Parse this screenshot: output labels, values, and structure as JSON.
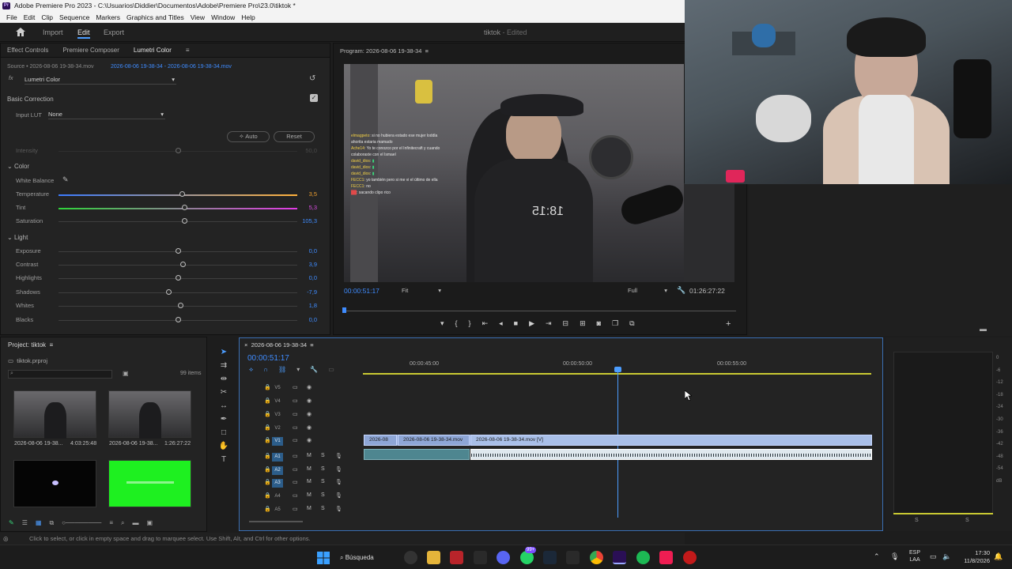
{
  "window": {
    "title": "Adobe Premiere Pro 2023 - C:\\Usuarios\\Diddier\\Documentos\\Adobe\\Premiere Pro\\23.0\\tiktok *",
    "app_badge": "Pr"
  },
  "menu": [
    "File",
    "Edit",
    "Clip",
    "Sequence",
    "Markers",
    "Graphics and Titles",
    "View",
    "Window",
    "Help"
  ],
  "workspace": {
    "tabs": [
      "Import",
      "Edit",
      "Export"
    ],
    "active": "Edit",
    "project_title": "tiktok",
    "project_status": "- Edited"
  },
  "left_panel": {
    "tabs": [
      "Effect Controls",
      "Premiere Composer",
      "Lumetri Color"
    ],
    "source": "Source • 2026-08-06 19-38-34.mov",
    "clip": "2026-08-06 19-38-34 - 2026-08-06 19-38-34.mov",
    "effect": "Lumetri Color",
    "fx": "fx",
    "basic_correction": "Basic Correction",
    "input_lut_label": "Input LUT",
    "input_lut_value": "None",
    "auto": "Auto",
    "reset": "Reset",
    "intensity_label": "Intensity",
    "intensity_value": "50,0",
    "color_section": "Color",
    "white_balance": "White Balance",
    "light_section": "Light",
    "sliders": [
      {
        "label": "Temperature",
        "value": "3,5",
        "pos": 0.52
      },
      {
        "label": "Tint",
        "value": "5,3",
        "pos": 0.53
      },
      {
        "label": "Saturation",
        "value": "105,3",
        "pos": 0.53
      },
      {
        "label": "Exposure",
        "value": "0,0",
        "pos": 0.5
      },
      {
        "label": "Contrast",
        "value": "3,9",
        "pos": 0.52
      },
      {
        "label": "Highlights",
        "value": "0,0",
        "pos": 0.5
      },
      {
        "label": "Shadows",
        "value": "-7,9",
        "pos": 0.46
      },
      {
        "label": "Whites",
        "value": "1,8",
        "pos": 0.51
      },
      {
        "label": "Blacks",
        "value": "0,0",
        "pos": 0.5
      }
    ]
  },
  "program": {
    "title": "Program: 2026-08-06 19-38-34",
    "timecode": "00:00:51:17",
    "fit": "Fit",
    "quality": "Full",
    "duration": "01:26:27:22",
    "shirt_text": "18:15",
    "chat": [
      {
        "user": "elmagpeto",
        "msg": "si no hubiera estado ese mujer loddla ahorita estaria mamado"
      },
      {
        "user": "Ache14",
        "msg": "Yo te conozco por el Infinitecraft y cuando colaboraste con el Ismael"
      },
      {
        "user": "david_dios",
        "msg": ""
      },
      {
        "user": "david_dios",
        "msg": ""
      },
      {
        "user": "david_dios",
        "msg": ""
      },
      {
        "user": "FECC1",
        "msg": "yo también pero si me vi el último de ella"
      },
      {
        "user": "FECC1",
        "msg": "no"
      },
      {
        "user": "",
        "msg": "sacando clipo rico"
      }
    ]
  },
  "project": {
    "title": "Project: tiktok",
    "file": "tiktok.prproj",
    "count": "99 items",
    "items": [
      {
        "name": "2026-08-06 19-38...",
        "duration": "4:03:25:48"
      },
      {
        "name": "2026-08-06 19-38...",
        "duration": "1:26:27:22"
      },
      {
        "name": "",
        "duration": ""
      },
      {
        "name": "",
        "duration": ""
      }
    ]
  },
  "timeline": {
    "sequence": "2026-08-06 19-38-34",
    "timecode": "00:00:51:17",
    "ruler": [
      "00:00:45:00",
      "00:00:50:00",
      "00:00:55:00"
    ],
    "video_tracks": [
      "V5",
      "V4",
      "V3",
      "V2",
      "V1"
    ],
    "audio_tracks": [
      "A1",
      "A2",
      "A3",
      "A4",
      "A5"
    ],
    "clips": [
      "2026-08",
      "2026-08-06 19-38-34.mov",
      "2026-08-06 19-38-34.mov [V]"
    ],
    "m": "M",
    "s": "S"
  },
  "meter": {
    "scale": [
      "0",
      "-6",
      "-12",
      "-18",
      "-24",
      "-30",
      "-36",
      "-42",
      "-48",
      "-54",
      "dB"
    ],
    "ch_left": "S",
    "ch_right": "S"
  },
  "status": "Click to select, or click in empty space and drag to marquee select. Use Shift, Alt, and Ctrl for other options.",
  "taskbar": {
    "search": "Búsqueda",
    "lang_top": "ESP",
    "lang_bottom": "LAA",
    "time": "17:30",
    "date": "11/8/2026",
    "badge": "99+"
  }
}
